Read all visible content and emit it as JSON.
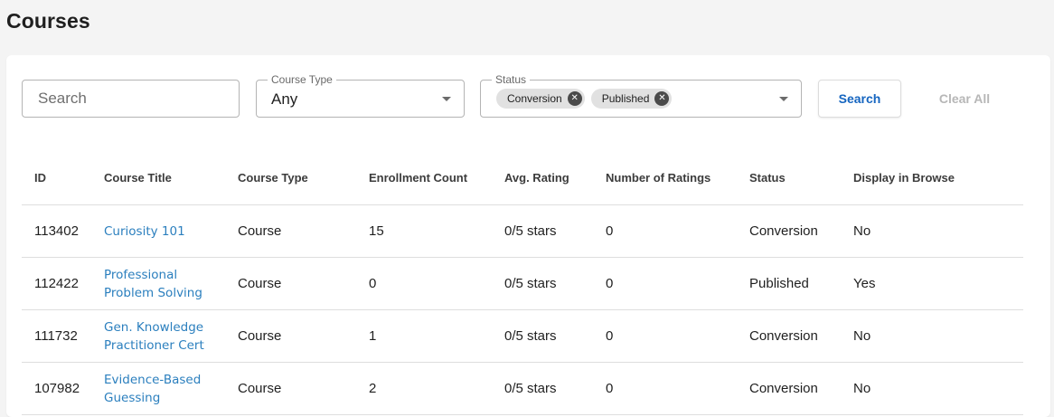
{
  "page_title": "Courses",
  "filters": {
    "search_placeholder": "Search",
    "course_type": {
      "label": "Course Type",
      "value": "Any"
    },
    "status": {
      "label": "Status",
      "chips": [
        "Conversion",
        "Published"
      ]
    },
    "search_button": "Search",
    "clear_button": "Clear All"
  },
  "table": {
    "headers": [
      "ID",
      "Course Title",
      "Course Type",
      "Enrollment Count",
      "Avg. Rating",
      "Number of Ratings",
      "Status",
      "Display in Browse"
    ],
    "rows": [
      {
        "id": "113402",
        "title": "Curiosity 101",
        "type": "Course",
        "enrollment": "15",
        "rating": "0/5 stars",
        "num_ratings": "0",
        "status": "Conversion",
        "display": "No"
      },
      {
        "id": "112422",
        "title": "Professional Problem Solving",
        "type": "Course",
        "enrollment": "0",
        "rating": "0/5 stars",
        "num_ratings": "0",
        "status": "Published",
        "display": "Yes"
      },
      {
        "id": "111732",
        "title": "Gen. Knowledge Practitioner Cert",
        "type": "Course",
        "enrollment": "1",
        "rating": "0/5 stars",
        "num_ratings": "0",
        "status": "Conversion",
        "display": "No"
      },
      {
        "id": "107982",
        "title": "Evidence-Based Guessing",
        "type": "Course",
        "enrollment": "2",
        "rating": "0/5 stars",
        "num_ratings": "0",
        "status": "Conversion",
        "display": "No"
      }
    ]
  },
  "icons": {
    "chip_remove": "close-circle-icon",
    "dropdown": "chevron-down-icon"
  },
  "colors": {
    "link": "#2b7fbe",
    "primary_button_text": "#1565c0",
    "disabled_text": "#b7b7b7",
    "page_background": "#f4f4f4"
  }
}
